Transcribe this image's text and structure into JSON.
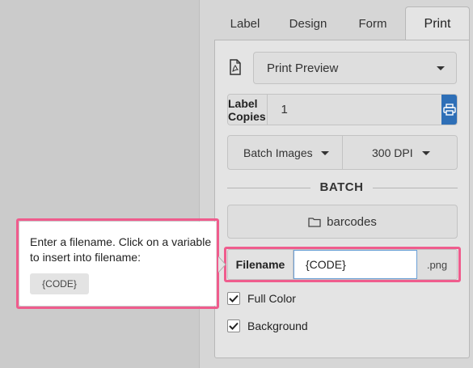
{
  "tabs": [
    {
      "label": "Label"
    },
    {
      "label": "Design"
    },
    {
      "label": "Form"
    },
    {
      "label": "Print",
      "active": true
    }
  ],
  "print": {
    "mode_icon": "pdf-file-icon",
    "mode_selected": "Print Preview",
    "copies_label": "Label Copies",
    "copies_value": "1",
    "print_icon": "printer-icon",
    "batch_images_label": "Batch Images",
    "dpi_label": "300 DPI",
    "batch_heading": "BATCH",
    "folder_icon": "folder-icon",
    "folder_label": "barcodes",
    "filename_label": "Filename",
    "filename_value": "{CODE}",
    "filename_ext": ".png",
    "full_color_label": "Full Color",
    "full_color_checked": true,
    "background_label": "Background",
    "background_checked": true
  },
  "tooltip": {
    "text": "Enter a filename. Click on a variable to insert into filename:",
    "variable": "{CODE}"
  },
  "colors": {
    "accent": "#2e6fb7",
    "highlight": "#ef5c8d"
  }
}
